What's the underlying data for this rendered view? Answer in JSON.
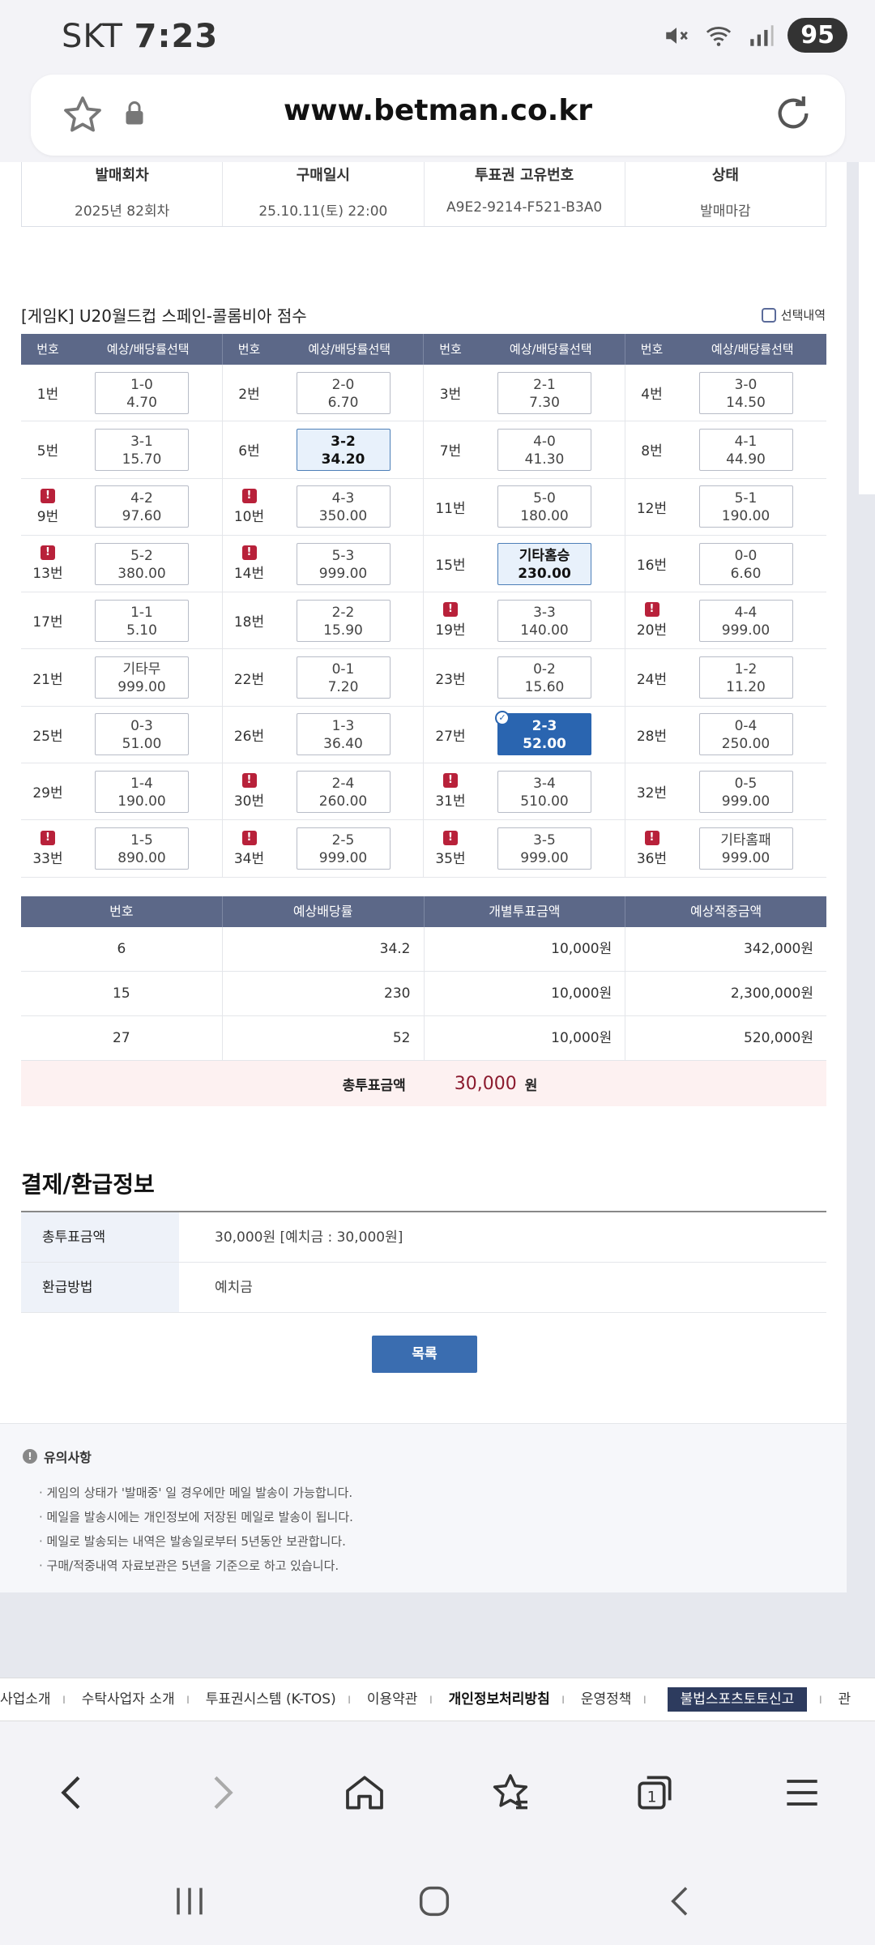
{
  "status": {
    "carrier": "SKT",
    "time": "7:23",
    "battery": "95"
  },
  "browser": {
    "url": "www.betman.co.kr"
  },
  "info": {
    "headers": [
      "발매회차",
      "구매일시",
      "투표권 고유번호",
      "상태"
    ],
    "values": [
      "2025년 82회차",
      "25.10.11(토) 22:00",
      "A9E2-9214-F521-B3A0",
      "발매마감"
    ]
  },
  "game": {
    "title": "[게임K] U20월드컵 스페인-콜롬비아 점수",
    "select_label": "선택내역",
    "col_no": "번호",
    "col_sel": "예상/배당률선택"
  },
  "grid": [
    [
      {
        "no": "1번",
        "s": "1-0",
        "o": "4.70"
      },
      {
        "no": "2번",
        "s": "2-0",
        "o": "6.70"
      },
      {
        "no": "3번",
        "s": "2-1",
        "o": "7.30"
      },
      {
        "no": "4번",
        "s": "3-0",
        "o": "14.50"
      }
    ],
    [
      {
        "no": "5번",
        "s": "3-1",
        "o": "15.70"
      },
      {
        "no": "6번",
        "s": "3-2",
        "o": "34.20",
        "st": "light"
      },
      {
        "no": "7번",
        "s": "4-0",
        "o": "41.30"
      },
      {
        "no": "8번",
        "s": "4-1",
        "o": "44.90"
      }
    ],
    [
      {
        "no": "9번",
        "s": "4-2",
        "o": "97.60",
        "w": true
      },
      {
        "no": "10번",
        "s": "4-3",
        "o": "350.00",
        "w": true
      },
      {
        "no": "11번",
        "s": "5-0",
        "o": "180.00"
      },
      {
        "no": "12번",
        "s": "5-1",
        "o": "190.00"
      }
    ],
    [
      {
        "no": "13번",
        "s": "5-2",
        "o": "380.00",
        "w": true
      },
      {
        "no": "14번",
        "s": "5-3",
        "o": "999.00",
        "w": true
      },
      {
        "no": "15번",
        "s": "기타홈승",
        "o": "230.00",
        "st": "light"
      },
      {
        "no": "16번",
        "s": "0-0",
        "o": "6.60"
      }
    ],
    [
      {
        "no": "17번",
        "s": "1-1",
        "o": "5.10"
      },
      {
        "no": "18번",
        "s": "2-2",
        "o": "15.90"
      },
      {
        "no": "19번",
        "s": "3-3",
        "o": "140.00",
        "w": true
      },
      {
        "no": "20번",
        "s": "4-4",
        "o": "999.00",
        "w": true
      }
    ],
    [
      {
        "no": "21번",
        "s": "기타무",
        "o": "999.00"
      },
      {
        "no": "22번",
        "s": "0-1",
        "o": "7.20"
      },
      {
        "no": "23번",
        "s": "0-2",
        "o": "15.60"
      },
      {
        "no": "24번",
        "s": "1-2",
        "o": "11.20"
      }
    ],
    [
      {
        "no": "25번",
        "s": "0-3",
        "o": "51.00"
      },
      {
        "no": "26번",
        "s": "1-3",
        "o": "36.40"
      },
      {
        "no": "27번",
        "s": "2-3",
        "o": "52.00",
        "st": "dark"
      },
      {
        "no": "28번",
        "s": "0-4",
        "o": "250.00"
      }
    ],
    [
      {
        "no": "29번",
        "s": "1-4",
        "o": "190.00"
      },
      {
        "no": "30번",
        "s": "2-4",
        "o": "260.00",
        "w": true
      },
      {
        "no": "31번",
        "s": "3-4",
        "o": "510.00",
        "w": true
      },
      {
        "no": "32번",
        "s": "0-5",
        "o": "999.00"
      }
    ],
    [
      {
        "no": "33번",
        "s": "1-5",
        "o": "890.00",
        "w": true
      },
      {
        "no": "34번",
        "s": "2-5",
        "o": "999.00",
        "w": true
      },
      {
        "no": "35번",
        "s": "3-5",
        "o": "999.00",
        "w": true
      },
      {
        "no": "36번",
        "s": "기타홈패",
        "o": "999.00",
        "w": true
      }
    ]
  ],
  "bet": {
    "headers": [
      "번호",
      "예상배당률",
      "개별투표금액",
      "예상적중금액"
    ],
    "rows": [
      [
        "6",
        "34.2",
        "10,000원",
        "342,000원"
      ],
      [
        "15",
        "230",
        "10,000원",
        "2,300,000원"
      ],
      [
        "27",
        "52",
        "10,000원",
        "520,000원"
      ]
    ],
    "total_label": "총투표금액",
    "total_amount": "30,000",
    "total_unit": "원"
  },
  "payment": {
    "title": "결제/환급정보",
    "rows": [
      {
        "label": "총투표금액",
        "value": "30,000원 [예치금 : 30,000원]"
      },
      {
        "label": "환급방법",
        "value": "예치금"
      }
    ],
    "list_button": "목록"
  },
  "notice": {
    "title": "유의사항",
    "items": [
      "게임의 상태가 '발매중' 일 경우에만 메일 발송이 가능합니다.",
      "메일을 발송시에는 개인정보에 저장된 메일로 발송이 됩니다.",
      "메일로 발송되는 내역은 발송일로부터 5년동안 보관합니다.",
      "구매/적중내역 자료보관은 5년을 기준으로 하고 있습니다."
    ]
  },
  "footer": {
    "items": [
      "사업소개",
      "수탁사업자 소개",
      "투표권시스템 (K-TOS)",
      "이용약관",
      "개인정보처리방침",
      "운영정책"
    ],
    "report": "불법스포츠토토신고",
    "tail": "관"
  },
  "colors": {
    "header": "#5c6888",
    "selected": "#2a65b0",
    "warning": "#b8213a",
    "total": "#8b1a2e"
  }
}
